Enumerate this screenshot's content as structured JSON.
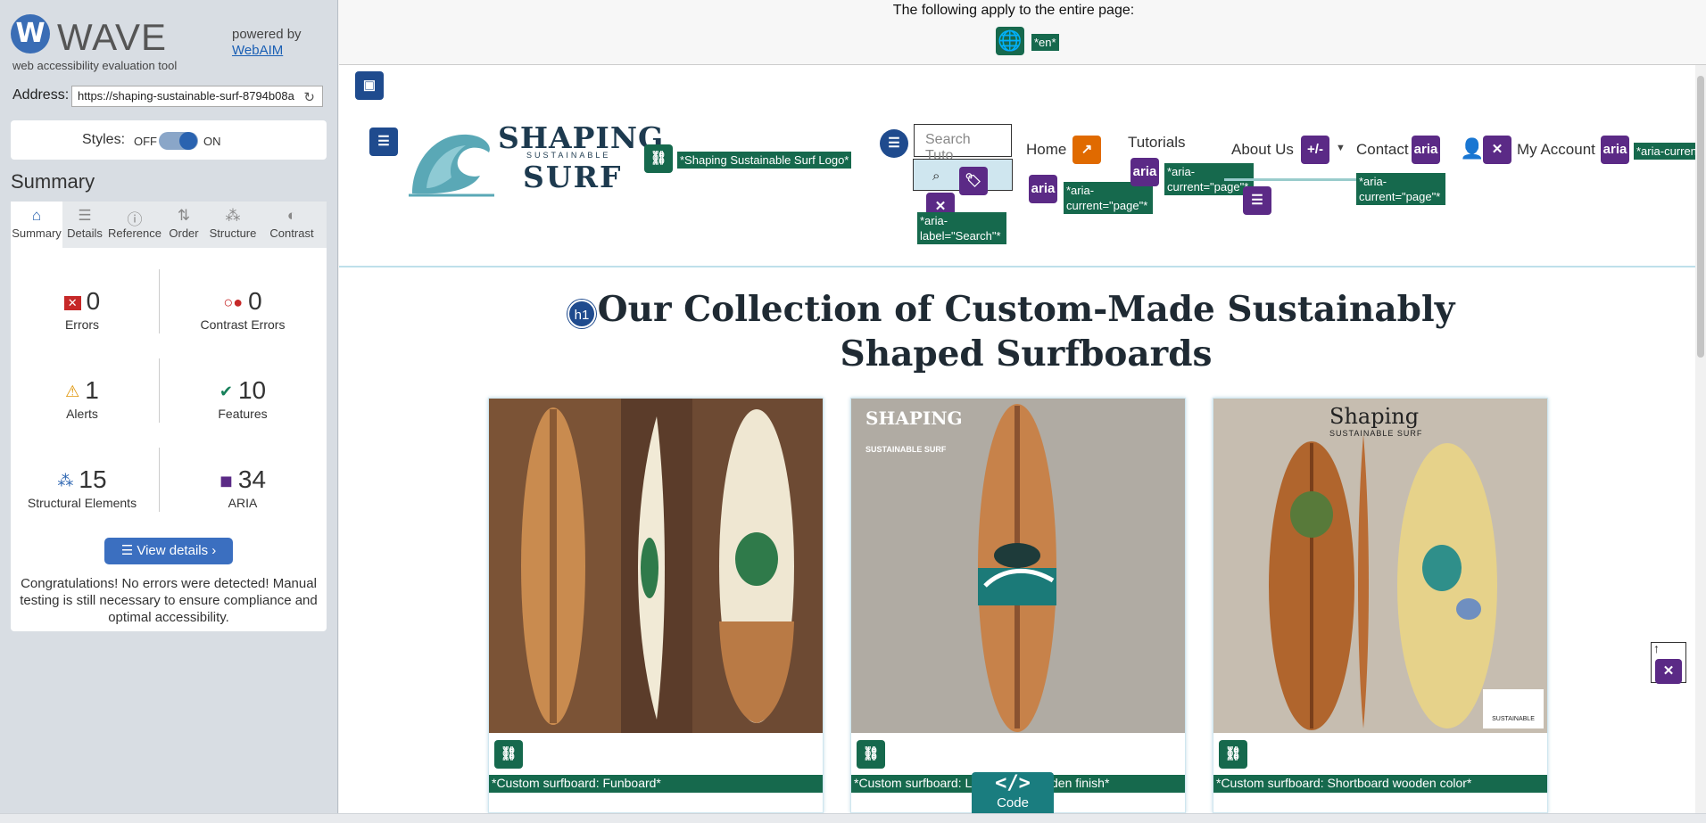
{
  "tool": {
    "name": "WAVE",
    "logo_letter": "W",
    "subtitle": "web accessibility evaluation tool",
    "powered_by": "powered by",
    "powered_link": "WebAIM"
  },
  "address": {
    "label": "Address:",
    "value": "https://shaping-sustainable-surf-8794b08a",
    "reload_icon": "reload-icon"
  },
  "styles": {
    "label": "Styles:",
    "off": "OFF",
    "on": "ON",
    "enabled": true
  },
  "summary": {
    "title": "Summary",
    "tabs": [
      {
        "label": "Summary",
        "icon": "home-icon",
        "glyph": "⌂",
        "active": true
      },
      {
        "label": "Details",
        "icon": "list-icon",
        "glyph": "☰",
        "active": false
      },
      {
        "label": "Reference",
        "icon": "info-icon",
        "glyph": "ⓘ",
        "active": false
      },
      {
        "label": "Order",
        "icon": "order-icon",
        "glyph": "⇅",
        "active": false
      },
      {
        "label": "Structure",
        "icon": "structure-icon",
        "glyph": "⁂",
        "active": false
      },
      {
        "label": "Contrast",
        "icon": "contrast-icon",
        "glyph": "◐",
        "active": false
      }
    ],
    "stats": {
      "errors": {
        "count": "0",
        "label": "Errors"
      },
      "contrast_errors": {
        "count": "0",
        "label": "Contrast Errors"
      },
      "alerts": {
        "count": "1",
        "label": "Alerts"
      },
      "features": {
        "count": "10",
        "label": "Features"
      },
      "structural": {
        "count": "15",
        "label": "Structural Elements"
      },
      "aria": {
        "count": "34",
        "label": "ARIA"
      }
    },
    "details_button": "View details ›",
    "message": "Congratulations! No errors were detected! Manual testing is still necessary to ensure compliance and optimal accessibility."
  },
  "page": {
    "banner_text": "The following apply to the entire page:",
    "lang_tag": "*en*",
    "brand": {
      "line1": "SHAPING",
      "line2": "SUSTAINABLE",
      "line3": "SURF"
    },
    "logo_alt_tag": "*Shaping Sustainable Surf Logo*",
    "search_placeholder": "Search Tuto",
    "search_label_tag": "*aria-label=\"Search\"*",
    "nav": {
      "home": "Home",
      "tutorials": "Tutorials",
      "about": "About Us",
      "contact": "Contact",
      "account": "My Account"
    },
    "aria_chip": "aria",
    "expand_chip": "+/-",
    "aria_current_tag": "*aria-current=\"page\"*",
    "aria_current_cut": "*aria-curren",
    "h1_badge": "h1",
    "heading": "Our Collection of Custom-Made Sustainably Shaped Surfboards",
    "cards": [
      {
        "caption": "*Custom surfboard: Funboard*"
      },
      {
        "caption": "*Custom surfboard: Longboard wooden finish*"
      },
      {
        "caption": "*Custom surfboard: Shortboard wooden color*"
      }
    ],
    "card2_logo_text": "SHAPING",
    "card2_logo_sub": "SUSTAINABLE SURF",
    "card3_logo_text": "Shaping",
    "card3_logo_sub": "SUSTAINABLE SURF",
    "card3_badge": "SUSTAINABLE",
    "code_symbol": "</>",
    "code_label": "Code"
  },
  "colors": {
    "wave_blue": "#3a6db5",
    "wave_green_tag": "#16694d",
    "aria_purple": "#5b2a86",
    "structure_blue": "#1f4b8e",
    "alert_orange": "#e06a00"
  }
}
